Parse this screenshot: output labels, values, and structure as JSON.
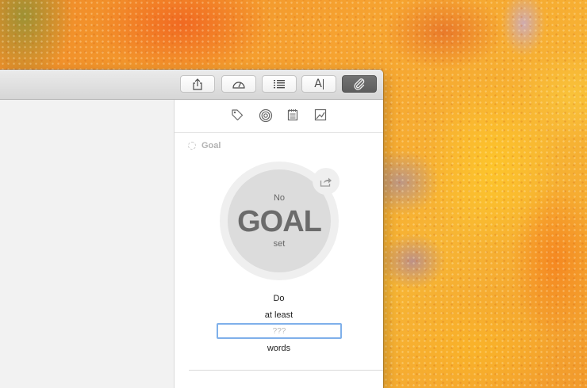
{
  "toolbar": {
    "buttons": [
      {
        "name": "share-button",
        "icon": "share-icon"
      },
      {
        "name": "dashboard-button",
        "icon": "speedometer-icon"
      },
      {
        "name": "outline-button",
        "icon": "list-icon"
      },
      {
        "name": "typewriter-button",
        "icon": "text-cursor-icon",
        "label": "A"
      },
      {
        "name": "attachments-button",
        "icon": "paperclip-icon",
        "active": true
      }
    ]
  },
  "panel": {
    "tabs": [
      {
        "name": "tab-keywords",
        "icon": "tag-icon"
      },
      {
        "name": "tab-goals",
        "icon": "target-icon"
      },
      {
        "name": "tab-notes",
        "icon": "notepad-icon"
      },
      {
        "name": "tab-images",
        "icon": "image-icon"
      }
    ],
    "goal": {
      "header": "Goal",
      "gauge_top": "No",
      "gauge_big": "GOAL",
      "gauge_bottom": "set",
      "line1": "Do",
      "line2": "at least",
      "input_placeholder": "???",
      "line3": "words"
    }
  },
  "colors": {
    "focus_ring": "#7fb0ea",
    "active_button": "#666666",
    "gauge_fill": "#dcdcdc"
  }
}
